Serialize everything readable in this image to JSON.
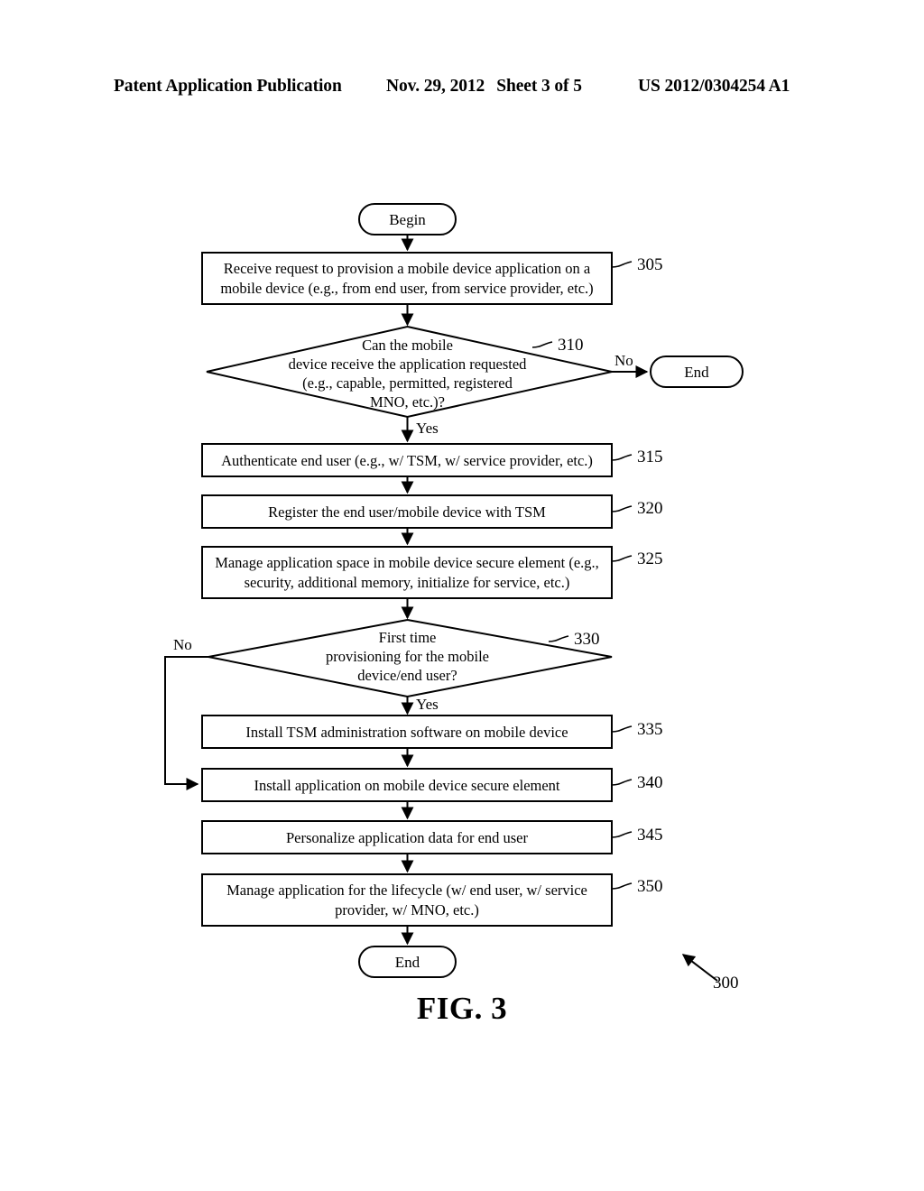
{
  "header": {
    "publication": "Patent Application Publication",
    "date": "Nov. 29, 2012",
    "sheet": "Sheet 3 of 5",
    "docnum": "US 2012/0304254 A1"
  },
  "figure": {
    "caption": "FIG. 3",
    "diagram_ref": "300"
  },
  "flowchart": {
    "begin_label": "Begin",
    "end_label_right": "End",
    "end_label_bottom": "End",
    "branch_yes_1": "Yes",
    "branch_no_1": "No",
    "branch_yes_2": "Yes",
    "branch_no_2": "No",
    "nodes": [
      {
        "ref": "305",
        "type": "process",
        "lines": [
          "Receive request to provision a mobile device application on a",
          "mobile device (e.g., from end user, from service provider, etc.)"
        ]
      },
      {
        "ref": "310",
        "type": "decision",
        "lines": [
          "Can the mobile",
          "device receive the application requested",
          "(e.g., capable, permitted, registered",
          "MNO, etc.)?"
        ]
      },
      {
        "ref": "315",
        "type": "process",
        "lines": [
          "Authenticate end user (e.g., w/ TSM, w/ service provider, etc.)"
        ]
      },
      {
        "ref": "320",
        "type": "process",
        "lines": [
          "Register the end user/mobile device with TSM"
        ]
      },
      {
        "ref": "325",
        "type": "process",
        "lines": [
          "Manage application space in mobile device secure element (e.g.,",
          "security, additional memory, initialize for service, etc.)"
        ]
      },
      {
        "ref": "330",
        "type": "decision",
        "lines": [
          "First time",
          "provisioning for the mobile",
          "device/end user?"
        ]
      },
      {
        "ref": "335",
        "type": "process",
        "lines": [
          "Install TSM administration software on mobile device"
        ]
      },
      {
        "ref": "340",
        "type": "process",
        "lines": [
          "Install application on mobile device secure element"
        ]
      },
      {
        "ref": "345",
        "type": "process",
        "lines": [
          "Personalize application data for end user"
        ]
      },
      {
        "ref": "350",
        "type": "process",
        "lines": [
          "Manage application for the lifecycle (w/ end user, w/ service",
          "provider, w/ MNO, etc.)"
        ]
      }
    ]
  }
}
